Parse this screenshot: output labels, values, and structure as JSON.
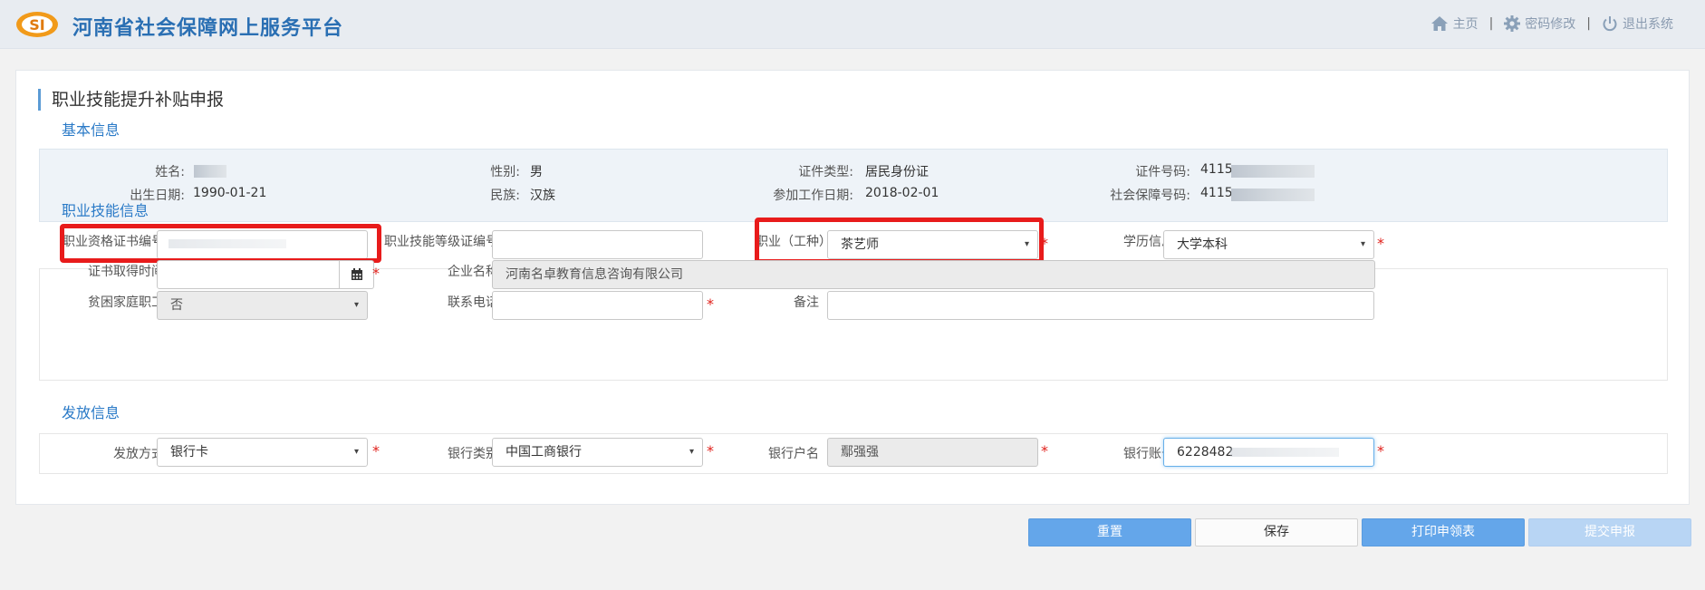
{
  "header": {
    "title": "河南省社会保障网上服务平台",
    "logo_text": "SI",
    "nav": {
      "home": "主页",
      "password": "密码修改",
      "logout": "退出系统",
      "separator": "|"
    }
  },
  "page": {
    "title": "职业技能提升补贴申报",
    "sections": {
      "basic": "基本信息",
      "skill": "职业技能信息",
      "payout": "发放信息"
    }
  },
  "basic_info": {
    "name": {
      "label": "姓名:",
      "value": ""
    },
    "gender": {
      "label": "性别:",
      "value": "男"
    },
    "id_type": {
      "label": "证件类型:",
      "value": "居民身份证"
    },
    "id_number": {
      "label": "证件号码:",
      "value": "4115"
    },
    "birth_date": {
      "label": "出生日期:",
      "value": "1990-01-21"
    },
    "ethnicity": {
      "label": "民族:",
      "value": "汉族"
    },
    "work_start": {
      "label": "参加工作日期:",
      "value": "2018-02-01"
    },
    "ss_number": {
      "label": "社会保障号码:",
      "value": "4115"
    }
  },
  "skill_info": {
    "cert_no": {
      "label": "职业资格证书编号",
      "value": ""
    },
    "level_cert_no": {
      "label": "职业技能等级证编号",
      "value": ""
    },
    "occupation": {
      "label": "职业（工种）",
      "value": "茶艺师"
    },
    "education": {
      "label": "学历信息",
      "value": "大学本科"
    },
    "cert_date": {
      "label": "证书取得时间",
      "value": ""
    },
    "company": {
      "label": "企业名称",
      "value": "河南名卓教育信息咨询有限公司"
    },
    "poor_family": {
      "label": "贫困家庭职工",
      "value": "否"
    },
    "phone": {
      "label": "联系电话",
      "value": ""
    },
    "remark": {
      "label": "备注",
      "value": ""
    }
  },
  "payout_info": {
    "method": {
      "label": "发放方式",
      "value": "银行卡"
    },
    "bank_type": {
      "label": "银行类别",
      "value": "中国工商银行"
    },
    "account_name": {
      "label": "银行户名",
      "value": "鄢强强"
    },
    "account_no": {
      "label": "银行账号",
      "value": "6228482"
    }
  },
  "required_mark": "*",
  "caret": "▾",
  "buttons": {
    "reset": "重置",
    "save": "保存",
    "print": "打印申领表",
    "submit": "提交申报"
  },
  "colors": {
    "accent": "#2a7ac7",
    "primary_button": "#64a6ea",
    "highlight": "#e81b1b",
    "required": "#e0201a"
  }
}
